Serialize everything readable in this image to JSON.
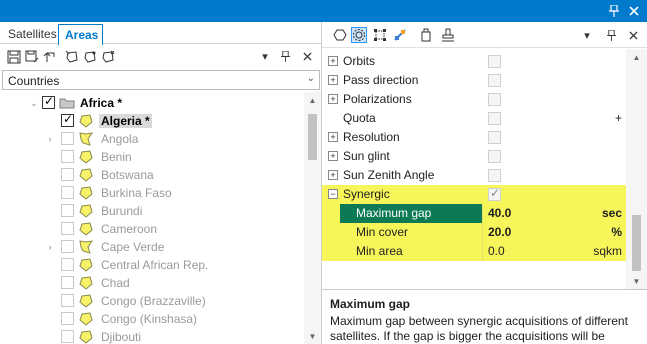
{
  "window": {
    "buttons": [
      "pin-icon",
      "close-icon"
    ]
  },
  "left_panel": {
    "tabs": [
      {
        "label": "Satellites",
        "active": false
      },
      {
        "label": "Areas",
        "active": true
      }
    ],
    "toolbar_icons": [
      "save-icon",
      "save-as-icon",
      "undo-icon",
      "add-area-icon",
      "edit-area-icon",
      "import-area-icon"
    ],
    "dropdown": {
      "value": "Countries"
    },
    "tree": {
      "root": {
        "label": "Africa *",
        "checked": true,
        "expanded": true
      },
      "items": [
        {
          "label": "Algeria *",
          "checked": true,
          "selected": true,
          "expandable": false,
          "dim": false
        },
        {
          "label": "Angola",
          "checked": false,
          "expandable": true,
          "dim": true
        },
        {
          "label": "Benin",
          "checked": false,
          "expandable": false,
          "dim": true
        },
        {
          "label": "Botswana",
          "checked": false,
          "expandable": false,
          "dim": true
        },
        {
          "label": "Burkina Faso",
          "checked": false,
          "expandable": false,
          "dim": true
        },
        {
          "label": "Burundi",
          "checked": false,
          "expandable": false,
          "dim": true
        },
        {
          "label": "Cameroon",
          "checked": false,
          "expandable": false,
          "dim": true
        },
        {
          "label": "Cape Verde",
          "checked": false,
          "expandable": true,
          "dim": true
        },
        {
          "label": "Central African Rep.",
          "checked": false,
          "expandable": false,
          "dim": true
        },
        {
          "label": "Chad",
          "checked": false,
          "expandable": false,
          "dim": true
        },
        {
          "label": "Congo (Brazzaville)",
          "checked": false,
          "expandable": false,
          "dim": true
        },
        {
          "label": "Congo (Kinshasa)",
          "checked": false,
          "expandable": false,
          "dim": true
        },
        {
          "label": "Djibouti",
          "checked": false,
          "expandable": false,
          "dim": true
        }
      ]
    }
  },
  "right_panel": {
    "toolbar_icons": [
      "polygon-icon",
      "settings-icon",
      "nodes-icon",
      "satellite-icon",
      "bottle-icon",
      "stamp-icon"
    ],
    "properties": [
      {
        "name": "Orbits",
        "expandable": true
      },
      {
        "name": "Pass direction",
        "expandable": true
      },
      {
        "name": "Polarizations",
        "expandable": true
      },
      {
        "name": "Quota",
        "expandable": false,
        "unit": "+"
      },
      {
        "name": "Resolution",
        "expandable": true
      },
      {
        "name": "Sun glint",
        "expandable": true
      },
      {
        "name": "Sun Zenith Angle",
        "expandable": true
      },
      {
        "name": "Synergic",
        "expandable": true,
        "expanded": true,
        "checked": true
      }
    ],
    "synergic_children": [
      {
        "name": "Maximum gap",
        "value": "40.0",
        "unit": "sec",
        "selected": true,
        "bold": true
      },
      {
        "name": "Min cover",
        "value": "20.0",
        "unit": "%",
        "selected": false,
        "bold": true
      },
      {
        "name": "Min area",
        "value": "0.0",
        "unit": "sqkm",
        "selected": false,
        "bold": false
      }
    ],
    "description": {
      "title": "Maximum gap",
      "text": "Maximum gap between synergic acquisitions of different satellites. If the gap is bigger the acquisitions will be removed"
    }
  },
  "colors": {
    "accent": "#007acc",
    "highlight_yellow": "#f6f65a",
    "selected_green": "#0b7a55"
  }
}
